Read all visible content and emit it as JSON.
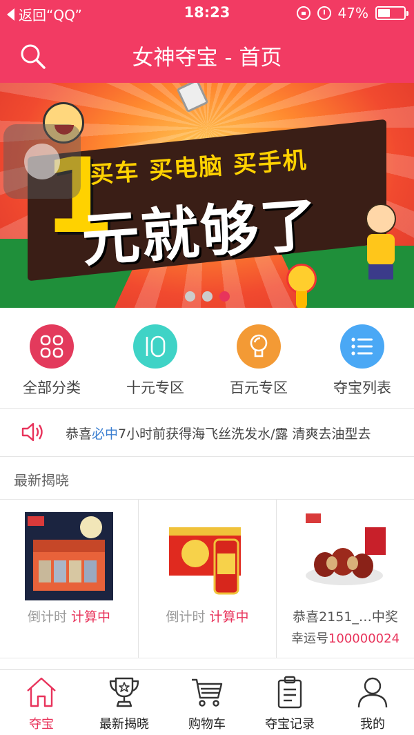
{
  "status": {
    "back_label": "返回“QQ”",
    "time": "18:23",
    "battery_text": "47%",
    "battery_level": 0.47
  },
  "header": {
    "title": "女神夺宝 - 首页",
    "search_icon": "search-icon"
  },
  "banner": {
    "subtitle": "买车 买电脑 买手机",
    "big_number": "1",
    "main_text": "元就够了",
    "slide_count": 3,
    "active_slide": 3
  },
  "categories": [
    {
      "label": "全部分类",
      "icon": "grid-icon",
      "color": "#e33a5c"
    },
    {
      "label": "十元专区",
      "icon": "ten-icon",
      "color": "#3fd3c6"
    },
    {
      "label": "百元专区",
      "icon": "bulb-icon",
      "color": "#f39a35"
    },
    {
      "label": "夺宝列表",
      "icon": "list-icon",
      "color": "#4aa8f5"
    }
  ],
  "notice": {
    "prefix": "恭喜",
    "name": "必中",
    "suffix": "7小时前获得海飞丝洗发水/露 清爽去油型去"
  },
  "latest": {
    "title": "最新揭晓",
    "items": [
      {
        "countdown_label": "倒计时",
        "status": "计算中"
      },
      {
        "countdown_label": "倒计时",
        "status": "计算中"
      },
      {
        "winner_text": "恭喜2151_…中奖",
        "lucky_label": "幸运号",
        "lucky_number": "100000024"
      }
    ]
  },
  "tabs": [
    {
      "label": "夺宝",
      "icon": "home-icon",
      "active": true
    },
    {
      "label": "最新揭晓",
      "icon": "trophy-icon",
      "active": false
    },
    {
      "label": "购物车",
      "icon": "cart-icon",
      "active": false
    },
    {
      "label": "夺宝记录",
      "icon": "clipboard-icon",
      "active": false
    },
    {
      "label": "我的",
      "icon": "user-icon",
      "active": false
    }
  ],
  "colors": {
    "brand": "#f23b63",
    "accent": "#e8335b",
    "link": "#3b7fd1"
  }
}
